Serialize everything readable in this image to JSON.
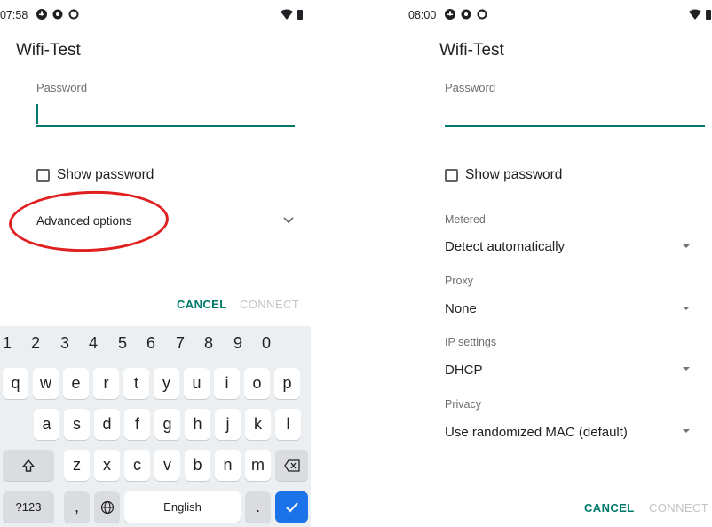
{
  "left": {
    "status": {
      "time": "07:58",
      "icons": [
        "app-notification-icon",
        "gear-icon",
        "sync-icon",
        "wifi-icon",
        "battery-icon"
      ]
    },
    "title": "Wifi-Test",
    "password_label": "Password",
    "password_value": "",
    "show_password": "Show password",
    "advanced_options": "Advanced options",
    "cancel": "CANCEL",
    "connect": "CONNECT",
    "annotation": "red-ellipse-highlight"
  },
  "keyboard": {
    "numbers": [
      "1",
      "2",
      "3",
      "4",
      "5",
      "6",
      "7",
      "8",
      "9",
      "0"
    ],
    "row1": [
      "q",
      "w",
      "e",
      "r",
      "t",
      "y",
      "u",
      "i",
      "o",
      "p"
    ],
    "row2": [
      "a",
      "s",
      "d",
      "f",
      "g",
      "h",
      "j",
      "k",
      "l"
    ],
    "row3": [
      "z",
      "x",
      "c",
      "v",
      "b",
      "n",
      "m"
    ],
    "sym": "?123",
    "comma": ",",
    "space": "English",
    "period": "."
  },
  "right": {
    "status": {
      "time": "08:00",
      "icons": [
        "app-notification-icon",
        "gear-icon",
        "sync-icon",
        "wifi-icon",
        "battery-icon"
      ]
    },
    "title": "Wifi-Test",
    "password_label": "Password",
    "show_password": "Show password",
    "settings": [
      {
        "label": "Metered",
        "value": "Detect automatically"
      },
      {
        "label": "Proxy",
        "value": "None"
      },
      {
        "label": "IP settings",
        "value": "DHCP"
      },
      {
        "label": "Privacy",
        "value": "Use randomized MAC (default)"
      }
    ],
    "cancel": "CANCEL",
    "connect": "CONNECT"
  },
  "colors": {
    "accent": "#00796b",
    "annotation": "#e02020",
    "enter_key": "#1a73e8"
  }
}
